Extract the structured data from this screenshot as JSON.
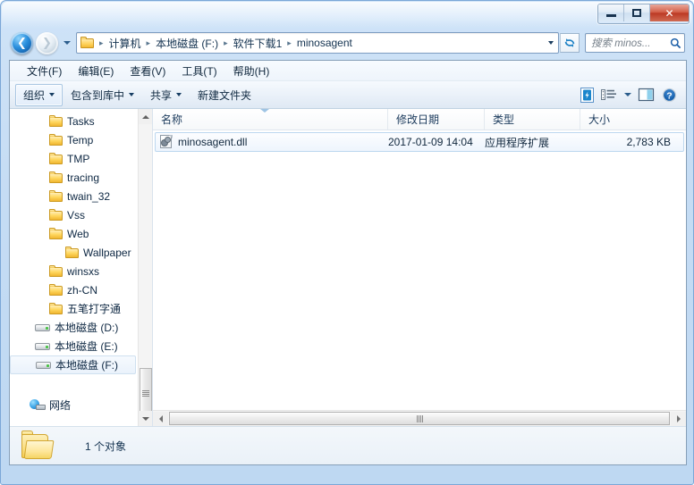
{
  "window": {
    "title": "",
    "buttons": {
      "minimize": "minimize-button",
      "maximize": "maximize-button",
      "close": "✕"
    }
  },
  "nav": {
    "back_glyph": "❮",
    "forward_glyph": "❯",
    "history_dropdown": "history-dropdown",
    "refresh_glyph": "↻",
    "breadcrumbs": [
      "计算机",
      "本地磁盘 (F:)",
      "软件下载1",
      "minosagent"
    ],
    "separator": "▸"
  },
  "search": {
    "placeholder": "搜索 minos...",
    "icon": "search-icon"
  },
  "menubar": {
    "items": [
      "文件(F)",
      "编辑(E)",
      "查看(V)",
      "工具(T)",
      "帮助(H)"
    ]
  },
  "toolbar": {
    "organize": "组织",
    "include_in_library": "包含到库中",
    "share": "共享",
    "new_folder": "新建文件夹",
    "icons": [
      "foxit-reader-icon",
      "change-view-icon",
      "preview-pane-icon",
      "help-icon"
    ],
    "help_glyph": "?"
  },
  "navpane": {
    "items": [
      {
        "label": "Tasks",
        "icon": "folder-icon",
        "indent": "ind-1",
        "selected": false
      },
      {
        "label": "Temp",
        "icon": "folder-icon",
        "indent": "ind-1",
        "selected": false
      },
      {
        "label": "TMP",
        "icon": "folder-icon",
        "indent": "ind-1",
        "selected": false
      },
      {
        "label": "tracing",
        "icon": "folder-icon",
        "indent": "ind-1",
        "selected": false
      },
      {
        "label": "twain_32",
        "icon": "folder-icon",
        "indent": "ind-1",
        "selected": false
      },
      {
        "label": "Vss",
        "icon": "folder-icon",
        "indent": "ind-1",
        "selected": false
      },
      {
        "label": "Web",
        "icon": "folder-icon",
        "indent": "ind-1",
        "selected": false
      },
      {
        "label": "Wallpaper",
        "icon": "folder-icon",
        "indent": "ind-2",
        "selected": false
      },
      {
        "label": "winsxs",
        "icon": "folder-icon",
        "indent": "ind-1",
        "selected": false
      },
      {
        "label": "zh-CN",
        "icon": "folder-icon",
        "indent": "ind-1",
        "selected": false
      },
      {
        "label": "五笔打字通",
        "icon": "folder-icon",
        "indent": "ind-1",
        "selected": false
      },
      {
        "label": "本地磁盘 (D:)",
        "icon": "drive-icon",
        "indent": "ind-drive",
        "selected": false
      },
      {
        "label": "本地磁盘 (E:)",
        "icon": "drive-icon",
        "indent": "ind-drive",
        "selected": false
      },
      {
        "label": "本地磁盘 (F:)",
        "icon": "drive-icon",
        "indent": "ind-drive",
        "selected": true
      },
      {
        "label": "",
        "icon": "spacer",
        "indent": "ind-drive",
        "selected": false
      },
      {
        "label": "网络",
        "icon": "network-icon",
        "indent": "ind-net",
        "selected": false
      }
    ]
  },
  "filelist": {
    "columns": [
      {
        "label": "名称",
        "cls": "c-name",
        "sorted": true
      },
      {
        "label": "修改日期",
        "cls": "c-date",
        "sorted": false
      },
      {
        "label": "类型",
        "cls": "c-type",
        "sorted": false
      },
      {
        "label": "大小",
        "cls": "c-size",
        "sorted": false
      }
    ],
    "rows": [
      {
        "name": "minosagent.dll",
        "date": "2017-01-09 14:04",
        "type": "应用程序扩展",
        "size": "2,783 KB",
        "icon": "dll-file-icon",
        "selected": true
      }
    ]
  },
  "statusbar": {
    "text": "1 个对象",
    "icon": "open-folder-icon"
  },
  "colors": {
    "frame": "#c5dcf4",
    "frame_border": "#7ba7d7",
    "close_red": "#bc3a25",
    "selection_blue": "#bcd7ef",
    "text": "#10273d",
    "folder_yellow": "#ffd75f"
  }
}
